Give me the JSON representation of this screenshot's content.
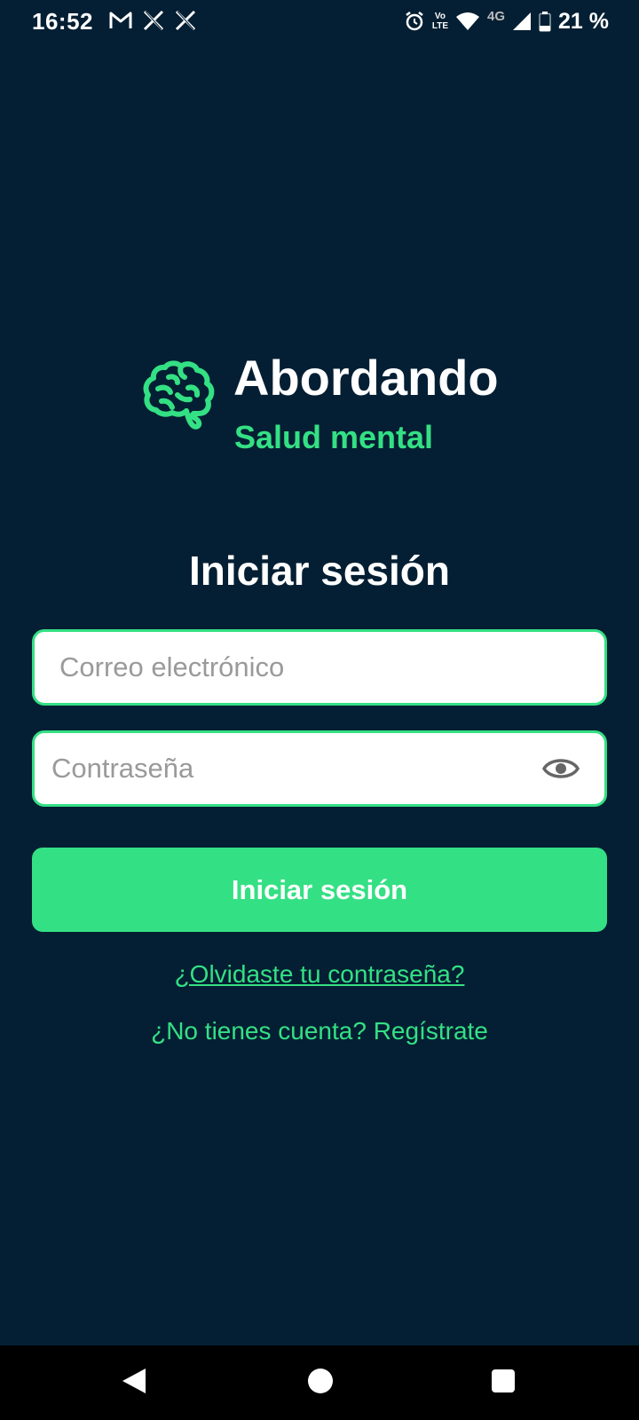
{
  "status_bar": {
    "time": "16:52",
    "notifications": [
      "gmail-icon",
      "x-icon",
      "x-icon"
    ],
    "volte_line1": "Vo",
    "volte_line2": "LTE",
    "network": "4G",
    "battery": "21 %"
  },
  "brand": {
    "title": "Abordando",
    "subtitle": "Salud mental",
    "logo_icon": "brain-icon",
    "accent_color": "#34e084",
    "background_color": "#041f33"
  },
  "form": {
    "heading": "Iniciar sesión",
    "email_placeholder": "Correo electrónico",
    "email_value": "",
    "password_placeholder": "Contraseña",
    "password_value": "",
    "password_toggle_icon": "eye-icon",
    "submit_label": "Iniciar sesión",
    "forgot_link": "¿Olvidaste tu contraseña?",
    "register_link": "¿No tienes cuenta? Regístrate"
  },
  "nav_bar": {
    "buttons": [
      "back-icon",
      "home-icon",
      "recents-icon"
    ]
  }
}
